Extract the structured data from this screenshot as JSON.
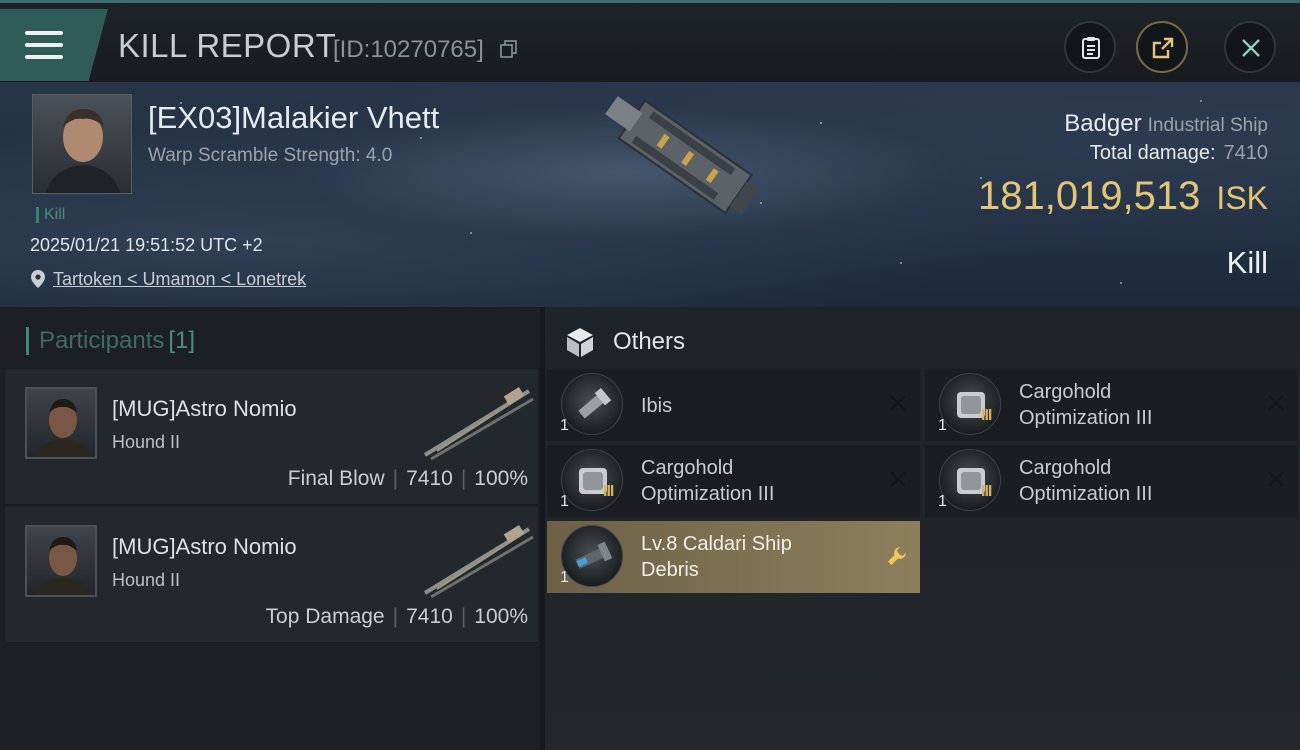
{
  "header": {
    "title": "KILL REPORT",
    "report_id": "[ID:10270765]",
    "menu_icon": "hamburger-menu-icon",
    "actions": [
      {
        "icon": "clipboard-icon"
      },
      {
        "icon": "share-export-icon"
      },
      {
        "icon": "close-icon"
      }
    ]
  },
  "victim": {
    "name": "[EX03]Malakier Vhett",
    "scramble": "Warp Scramble Strength: 4.0",
    "tag": "Kill",
    "datetime": "2025/01/21 19:51:52 UTC +2",
    "location": "Tartoken < Umamon < Lonetrek",
    "ship_name": "Badger",
    "ship_class": "Industrial Ship",
    "total_damage_label": "Total damage:",
    "total_damage": "7410",
    "isk_value": "181,019,513",
    "isk_unit": "ISK",
    "result": "Kill"
  },
  "participants": {
    "label": "Participants",
    "count": "[1]",
    "rows": [
      {
        "name": "[MUG]Astro Nomio",
        "ship": "Hound II",
        "role": "Final Blow",
        "damage": "7410",
        "percent": "100%"
      },
      {
        "name": "[MUG]Astro Nomio",
        "ship": "Hound II",
        "role": "Top Damage",
        "damage": "7410",
        "percent": "100%"
      }
    ]
  },
  "others": {
    "title": "Others",
    "items": [
      {
        "name": "Ibis",
        "qty": "1",
        "tier": "",
        "state": "destroyed"
      },
      {
        "name": "Cargohold Optimization III",
        "qty": "1",
        "tier": "III",
        "state": "destroyed"
      },
      {
        "name": "Cargohold Optimization III",
        "qty": "1",
        "tier": "III",
        "state": "destroyed"
      },
      {
        "name": "Cargohold Optimization III",
        "qty": "1",
        "tier": "III",
        "state": "destroyed"
      },
      {
        "name": "Lv.8 Caldari Ship Debris",
        "qty": "1",
        "tier": "",
        "state": "dropped"
      }
    ]
  },
  "colors": {
    "accent": "#3e8a79",
    "isk": "#e3c574",
    "highlight": "#8e7f5c"
  }
}
